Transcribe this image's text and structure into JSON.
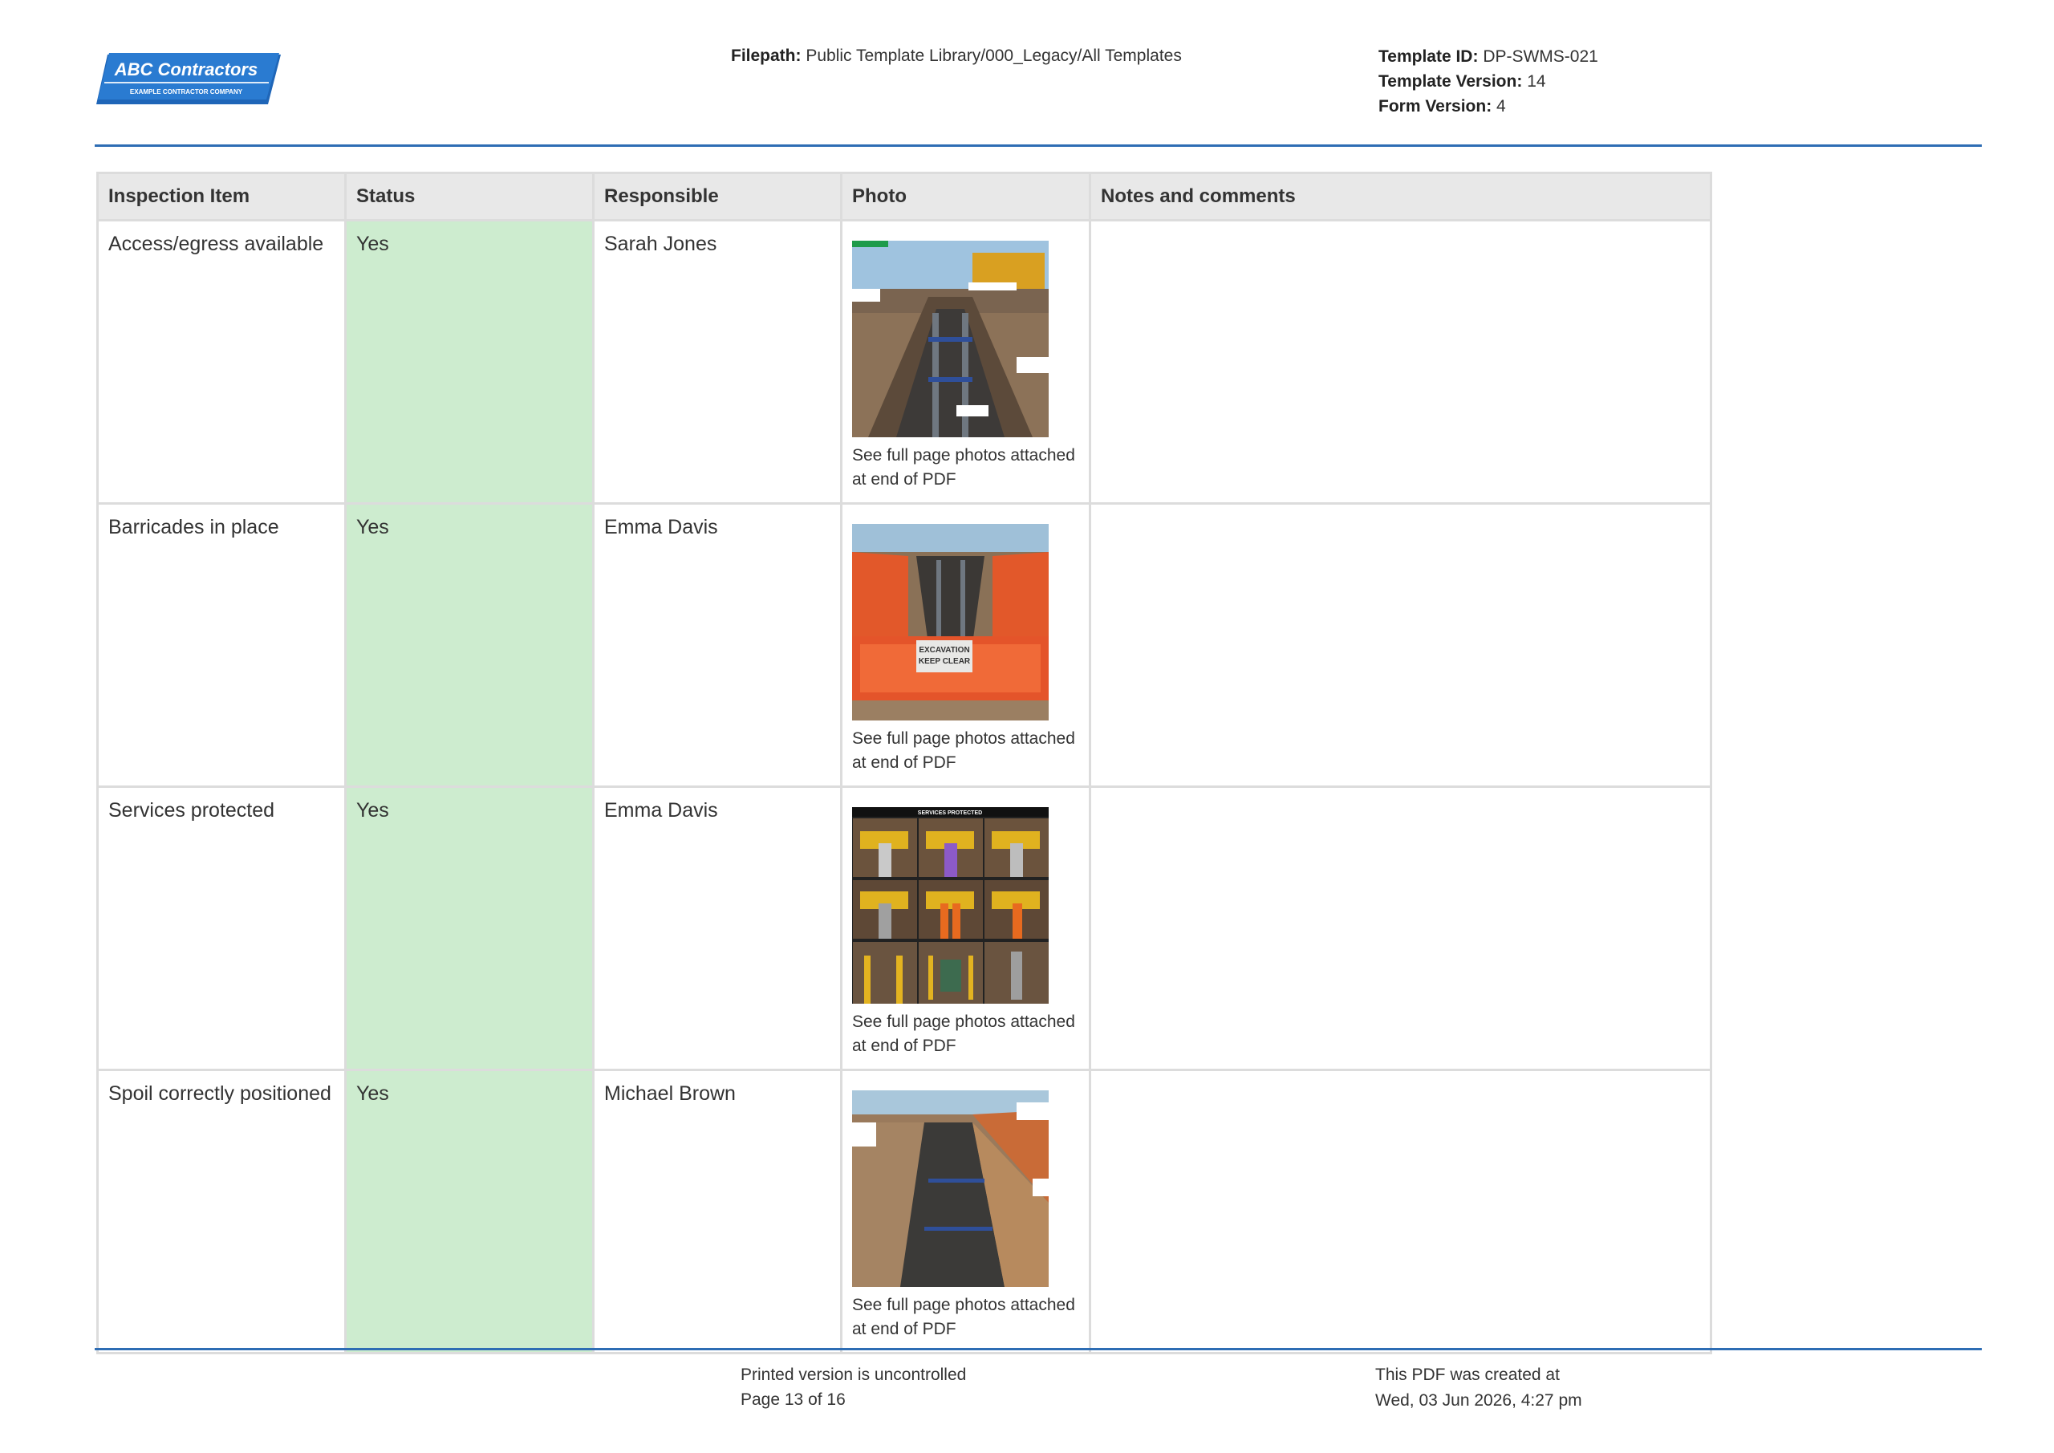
{
  "header": {
    "logo_title": "ABC Contractors",
    "logo_subtitle": "EXAMPLE CONTRACTOR COMPANY",
    "filepath_label": "Filepath:",
    "filepath_value": "Public Template Library/000_Legacy/All Templates",
    "template_id_label": "Template ID:",
    "template_id_value": "DP-SWMS-021",
    "template_version_label": "Template Version:",
    "template_version_value": "14",
    "form_version_label": "Form Version:",
    "form_version_value": "4"
  },
  "table": {
    "columns": [
      "Inspection Item",
      "Status",
      "Responsible",
      "Photo",
      "Notes and comments"
    ],
    "rows": [
      {
        "item": "Access/egress available",
        "status": "Yes",
        "responsible": "Sarah Jones",
        "photo": "trench-shoring-photo",
        "caption": "See full page photos attached at end of PDF",
        "notes": ""
      },
      {
        "item": "Barricades in place",
        "status": "Yes",
        "responsible": "Emma Davis",
        "photo": "excavation-barricade-photo",
        "caption": "See full page photos attached at end of PDF",
        "notes": ""
      },
      {
        "item": "Services protected",
        "status": "Yes",
        "responsible": "Emma Davis",
        "photo": "services-protected-collage-photo",
        "caption": "See full page photos attached at end of PDF",
        "notes": ""
      },
      {
        "item": "Spoil correctly positioned",
        "status": "Yes",
        "responsible": "Michael Brown",
        "photo": "spoil-trench-photo",
        "caption": "See full page photos attached at end of PDF",
        "notes": ""
      }
    ],
    "photo_overlay_texts": {
      "row3_collage_title": "SERVICES PROTECTED",
      "row2_sign_line1": "EXCAVATION",
      "row2_sign_line2": "KEEP CLEAR"
    }
  },
  "footer": {
    "uncontrolled": "Printed version is uncontrolled",
    "page": "Page 13 of 16",
    "created_label": "This PDF was created at",
    "created_value": "Wed, 03 Jun 2026, 4:27 pm"
  },
  "colors": {
    "accent_rule": "#2e6db4",
    "logo_blue": "#2a7bd1",
    "status_yes_bg": "#cdeccf",
    "header_bg": "#e8e8e8"
  }
}
